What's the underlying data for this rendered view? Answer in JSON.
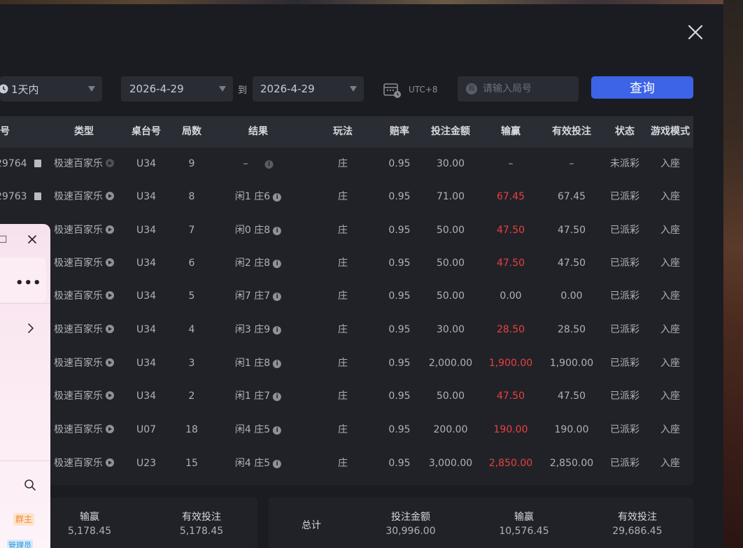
{
  "header": {
    "filter_range": "1天内",
    "date_start": "2026-4-29",
    "date_to": "到",
    "date_end": "2026-4-29",
    "timezone": "UTC+8",
    "round_placeholder": "请输入局号",
    "search_badge": "局",
    "query_button": "查询"
  },
  "table": {
    "columns": [
      "号",
      "类型",
      "桌台号",
      "局数",
      "结果",
      "玩法",
      "赔率",
      "投注金额",
      "输赢",
      "有效投注",
      "状态",
      "游戏模式"
    ],
    "rows": [
      {
        "id": "29764",
        "type": "极速百家乐",
        "table": "U34",
        "round": "9",
        "result": "–",
        "bet_type": "庄",
        "odds": "0.95",
        "amount": "30.00",
        "winloss": "–",
        "valid": "–",
        "status": "未派彩",
        "mode": "入座",
        "win_red": false,
        "pending": true
      },
      {
        "id": "29763",
        "type": "极速百家乐",
        "table": "U34",
        "round": "8",
        "result": "闲1 庄6",
        "bet_type": "庄",
        "odds": "0.95",
        "amount": "71.00",
        "winloss": "67.45",
        "valid": "67.45",
        "status": "已派彩",
        "mode": "入座",
        "win_red": true,
        "pending": false
      },
      {
        "id": "",
        "type": "极速百家乐",
        "table": "U34",
        "round": "7",
        "result": "闲0 庄8",
        "bet_type": "庄",
        "odds": "0.95",
        "amount": "50.00",
        "winloss": "47.50",
        "valid": "47.50",
        "status": "已派彩",
        "mode": "入座",
        "win_red": true,
        "pending": false
      },
      {
        "id": "",
        "type": "极速百家乐",
        "table": "U34",
        "round": "6",
        "result": "闲2 庄8",
        "bet_type": "庄",
        "odds": "0.95",
        "amount": "50.00",
        "winloss": "47.50",
        "valid": "47.50",
        "status": "已派彩",
        "mode": "入座",
        "win_red": true,
        "pending": false
      },
      {
        "id": "",
        "type": "极速百家乐",
        "table": "U34",
        "round": "5",
        "result": "闲7 庄7",
        "bet_type": "庄",
        "odds": "0.95",
        "amount": "50.00",
        "winloss": "0.00",
        "valid": "0.00",
        "status": "已派彩",
        "mode": "入座",
        "win_red": false,
        "pending": false
      },
      {
        "id": "",
        "type": "极速百家乐",
        "table": "U34",
        "round": "4",
        "result": "闲3 庄9",
        "bet_type": "庄",
        "odds": "0.95",
        "amount": "30.00",
        "winloss": "28.50",
        "valid": "28.50",
        "status": "已派彩",
        "mode": "入座",
        "win_red": true,
        "pending": false
      },
      {
        "id": "",
        "type": "极速百家乐",
        "table": "U34",
        "round": "3",
        "result": "闲1 庄8",
        "bet_type": "庄",
        "odds": "0.95",
        "amount": "2,000.00",
        "winloss": "1,900.00",
        "valid": "1,900.00",
        "status": "已派彩",
        "mode": "入座",
        "win_red": true,
        "pending": false
      },
      {
        "id": "",
        "type": "极速百家乐",
        "table": "U34",
        "round": "2",
        "result": "闲1 庄7",
        "bet_type": "庄",
        "odds": "0.95",
        "amount": "50.00",
        "winloss": "47.50",
        "valid": "47.50",
        "status": "已派彩",
        "mode": "入座",
        "win_red": true,
        "pending": false
      },
      {
        "id": "",
        "type": "极速百家乐",
        "table": "U07",
        "round": "18",
        "result": "闲4 庄5",
        "bet_type": "庄",
        "odds": "0.95",
        "amount": "200.00",
        "winloss": "190.00",
        "valid": "190.00",
        "status": "已派彩",
        "mode": "入座",
        "win_red": true,
        "pending": false
      },
      {
        "id": "",
        "type": "极速百家乐",
        "table": "U23",
        "round": "15",
        "result": "闲4 庄5",
        "bet_type": "庄",
        "odds": "0.95",
        "amount": "3,000.00",
        "winloss": "2,850.00",
        "valid": "2,850.00",
        "status": "已派彩",
        "mode": "入座",
        "win_red": true,
        "pending": false
      }
    ]
  },
  "summary_page": {
    "winloss_label": "输赢",
    "winloss_value": "5,178.45",
    "valid_label": "有效投注",
    "valid_value": "5,178.45"
  },
  "summary_total": {
    "title": "总计",
    "amount_label": "投注金额",
    "amount_value": "30,996.00",
    "winloss_label": "输赢",
    "winloss_value": "10,576.45",
    "valid_label": "有效投注",
    "valid_value": "29,686.45"
  },
  "chat_popup": {
    "title_fragment": "□",
    "owner_badge": "群主",
    "admin_badge": "管理员"
  },
  "colors": {
    "accent": "#3d63e6",
    "loss_win_red": "#e8413f"
  }
}
